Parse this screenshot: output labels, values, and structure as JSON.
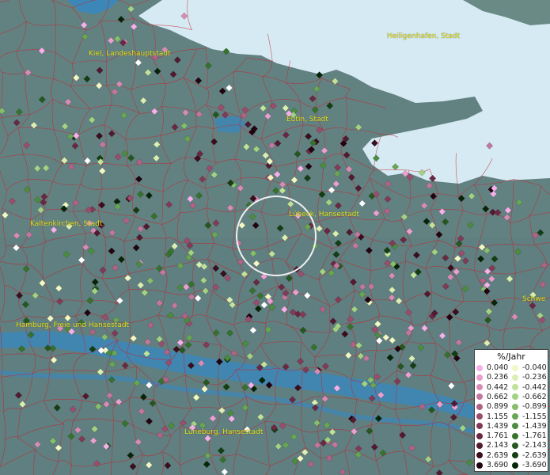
{
  "legend": {
    "title": "%/Jahr",
    "positive": [
      {
        "label": "0.040",
        "color": "#f4b0e8"
      },
      {
        "label": "0.236",
        "color": "#e8a0cf"
      },
      {
        "label": "0.442",
        "color": "#d68cb5"
      },
      {
        "label": "0.662",
        "color": "#c2789d"
      },
      {
        "label": "0.899",
        "color": "#b06386"
      },
      {
        "label": "1.155",
        "color": "#9a4d6d"
      },
      {
        "label": "1.439",
        "color": "#823a57"
      },
      {
        "label": "1.761",
        "color": "#6a2843"
      },
      {
        "label": "2.143",
        "color": "#521a30"
      },
      {
        "label": "2.639",
        "color": "#3a0e1e"
      },
      {
        "label": "3.690",
        "color": "#220410"
      }
    ],
    "negative": [
      {
        "label": "-0.040",
        "color": "#f2f8c4"
      },
      {
        "label": "-0.236",
        "color": "#dcefb2"
      },
      {
        "label": "-0.442",
        "color": "#c2e29c"
      },
      {
        "label": "-0.662",
        "color": "#a4d284"
      },
      {
        "label": "-0.899",
        "color": "#86be6c"
      },
      {
        "label": "-1.155",
        "color": "#68a654"
      },
      {
        "label": "-1.439",
        "color": "#4c8c3e"
      },
      {
        "label": "-1.761",
        "color": "#36722c"
      },
      {
        "label": "-2.143",
        "color": "#24581e"
      },
      {
        "label": "-2.639",
        "color": "#143e12"
      },
      {
        "label": "-3.690",
        "color": "#082408"
      }
    ]
  },
  "cities": [
    {
      "id": "kiel",
      "label": "Kiel, Landeshauptstadt"
    },
    {
      "id": "heiligenhafen",
      "label": "Heiligenhafen, Stadt"
    },
    {
      "id": "eutin",
      "label": "Eutin, Stadt"
    },
    {
      "id": "luebeck",
      "label": "Lübeck, Hansestadt"
    },
    {
      "id": "kaltenkirchen",
      "label": "Kaltenkirchen, Stadt"
    },
    {
      "id": "hamburg",
      "label": "Hamburg, Freie und Hansestadt"
    },
    {
      "id": "lueneburg",
      "label": "Lüneburg, Hansestadt"
    },
    {
      "id": "schwerin",
      "label": "Schwe"
    }
  ],
  "colors": {
    "sea": "#d6eaf4",
    "land": "#5f7f80",
    "boundary": "#c8202a",
    "river": "#3c87b8",
    "label": "#e8e020",
    "highlight_ring": "#f0f0f0"
  }
}
